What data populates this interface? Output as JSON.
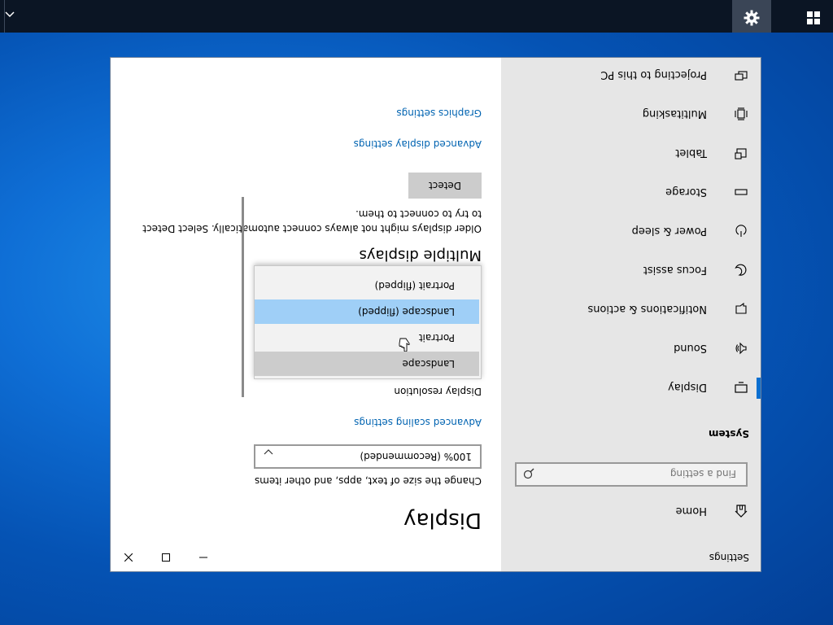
{
  "taskbar": {
    "start_icon": "windows-logo-icon",
    "settings_icon": "gear-icon",
    "overflow_icon": "chevron-up-icon"
  },
  "window": {
    "title": "Settings",
    "controls": {
      "minimize": "minimize-icon",
      "maximize": "maximize-icon",
      "close": "close-icon"
    }
  },
  "sidebar": {
    "home": {
      "label": "Home",
      "icon": "home-icon"
    },
    "search": {
      "placeholder": "Find a setting",
      "icon": "search-icon"
    },
    "section_heading": "System",
    "items": [
      {
        "label": "Display",
        "icon": "display-icon",
        "selected": true
      },
      {
        "label": "Sound",
        "icon": "speaker-icon"
      },
      {
        "label": "Notifications & actions",
        "icon": "notifications-icon"
      },
      {
        "label": "Focus assist",
        "icon": "moon-icon"
      },
      {
        "label": "Power & sleep",
        "icon": "power-icon"
      },
      {
        "label": "Storage",
        "icon": "storage-icon"
      },
      {
        "label": "Tablet",
        "icon": "tablet-icon"
      },
      {
        "label": "Multitasking",
        "icon": "multitasking-icon"
      },
      {
        "label": "Projecting to this PC",
        "icon": "projector-icon"
      }
    ],
    "accent": "#0b6fd0"
  },
  "main": {
    "title": "Display",
    "scale_label": "Change the size of text, apps, and other items",
    "scale_value": "100% (Recommended)",
    "advanced_scaling_link": "Advanced scaling settings",
    "resolution_label": "Display resolution",
    "orientation_options": [
      {
        "label": "Landscape",
        "state": "hover"
      },
      {
        "label": "Portrait",
        "state": "normal"
      },
      {
        "label": "Landscape (flipped)",
        "state": "selected"
      },
      {
        "label": "Portrait (flipped)",
        "state": "normal"
      }
    ],
    "multiple_displays_heading": "Multiple displays",
    "multiple_displays_desc": "Older displays might not always connect automatically. Select Detect to try to connect to them.",
    "detect_button": "Detect",
    "advanced_display_link": "Advanced display settings",
    "graphics_link": "Graphics settings",
    "link_color": "#0063b1"
  }
}
